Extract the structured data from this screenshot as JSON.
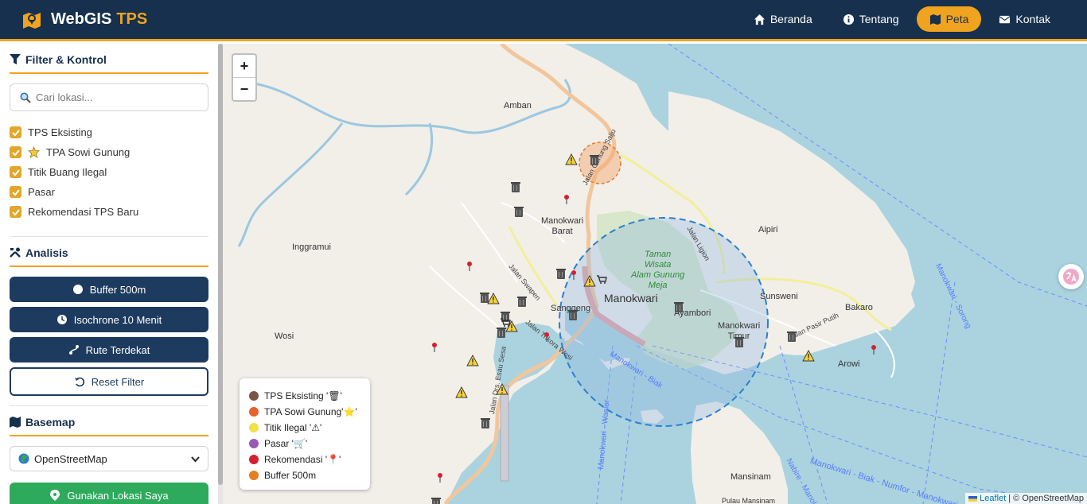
{
  "brand": {
    "title": "WebGIS",
    "accent": "TPS"
  },
  "nav": [
    {
      "label": "Beranda",
      "icon": "home-icon"
    },
    {
      "label": "Tentang",
      "icon": "info-icon"
    },
    {
      "label": "Peta",
      "icon": "map-icon",
      "active": true
    },
    {
      "label": "Kontak",
      "icon": "envelope-icon"
    }
  ],
  "sidebar": {
    "filter_title": "Filter & Kontrol",
    "search_placeholder": "Cari lokasi...",
    "layers": [
      {
        "label": "TPS Eksisting",
        "checked": true
      },
      {
        "label": "TPA Sowi Gunung",
        "checked": true,
        "icon": "star-icon"
      },
      {
        "label": "Titik Buang Ilegal",
        "checked": true
      },
      {
        "label": "Pasar",
        "checked": true
      },
      {
        "label": "Rekomendasi TPS Baru",
        "checked": true
      }
    ],
    "analysis_title": "Analisis",
    "buttons": {
      "buffer": "Buffer 500m",
      "isochrone": "Isochrone 10 Menit",
      "route": "Rute Terdekat",
      "reset": "Reset Filter"
    },
    "basemap_title": "Basemap",
    "basemap_selected": "OpenStreetMap",
    "locate_button": "Gunakan Lokasi Saya"
  },
  "map": {
    "zoom_in": "+",
    "zoom_out": "−",
    "labels": {
      "amban": "Amban",
      "manokwari_barat": "Manokwari\nBarat",
      "inggramui": "Inggramui",
      "wosi": "Wosi",
      "sanggeng": "Sanggeng",
      "manokwari": "Manokwari",
      "amyambori": "Ayambori",
      "manokwari_timur": "Manokwari\nTimur",
      "taman": "Taman\nWisata\nAlam Gunung\nMeja",
      "sunsweni": "Sunsweni",
      "aipiri": "Aipiri",
      "bakaro": "Bakaro",
      "arowi": "Arowi",
      "mansinam": "Mansinam",
      "biak_route": "Manokwari - Biak - Numfor - Manokwari",
      "sorong_route": "Manokwari - Sorong",
      "jalan_swapen": "Jalan Swapen",
      "jalan_gunung_salju": "Jalan Gunung Salju",
      "jalan_ligion": "Jalan Ligion",
      "jalan_trikora": "Jalan Trikora Wosi",
      "jalan_esau": "Jalan Drs. Esau Sesa",
      "jalan_pasir_putih": "Jalan Pasir Putih",
      "manokwari_biak": "Manokwari - Biak",
      "manokwari_wasior": "Manokwari - Wasior",
      "nabire": "Nabire - Manokwari",
      "pulau_mansinam": "Pulau Mansinam"
    },
    "legend": [
      {
        "label": "TPS Eksisting '🗑'",
        "color": "#795548"
      },
      {
        "label": "TPA Sowi Gunung'⭐'",
        "color": "#e8612c"
      },
      {
        "label": "Titik Ilegal '⚠'",
        "color": "#f0e04a"
      },
      {
        "label": "Pasar '🛒'",
        "color": "#9b59b6"
      },
      {
        "label": "Rekomendasi '📍'",
        "color": "#d6202f"
      },
      {
        "label": "Buffer 500m",
        "color": "#e67e22"
      }
    ],
    "attribution_leaflet": "Leaflet",
    "attribution_osm": "| © OpenStreetMap"
  },
  "colors": {
    "navy": "#16304d",
    "accent": "#f0a31e",
    "water": "#aad3df",
    "land": "#f2efe9"
  }
}
